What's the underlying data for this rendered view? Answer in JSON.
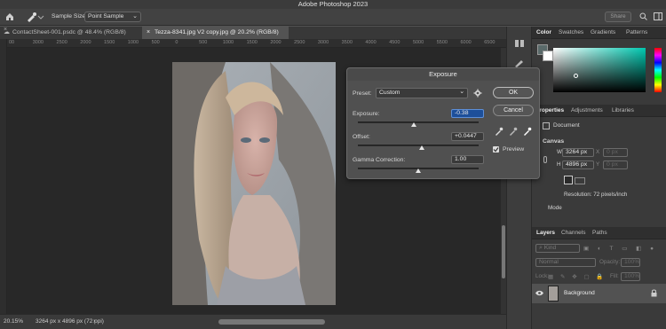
{
  "app": {
    "title": "Adobe Photoshop 2023"
  },
  "options_bar": {
    "sample_size_label": "Sample Size:",
    "sample_size_value": "Point Sample",
    "share_label": "Share"
  },
  "tabs": [
    {
      "label": "ContactSheet-001.psdc @ 48.4% (RGB/8)",
      "active": false
    },
    {
      "label": "Tezza-8341.jpg V2 copy.jpg @ 20.2% (RGB/8)",
      "active": true
    }
  ],
  "ruler": {
    "marks": [
      "00",
      "3000",
      "2500",
      "2000",
      "1500",
      "1000",
      "500",
      "0",
      "500",
      "1000",
      "1500",
      "2000",
      "2500",
      "3000",
      "3500",
      "4000",
      "4500",
      "5000",
      "5500",
      "6000",
      "6500"
    ]
  },
  "status": {
    "zoom": "20.15%",
    "doc_info": "3264 px x 4896 px (72 ppi)"
  },
  "dialog": {
    "title": "Exposure",
    "preset_label": "Preset:",
    "preset_value": "Custom",
    "ok_label": "OK",
    "cancel_label": "Cancel",
    "preview_label": "Preview",
    "preview_checked": true,
    "exposure_label": "Exposure:",
    "exposure_value": "-0.38",
    "offset_label": "Offset:",
    "offset_value": "+0.0447",
    "gamma_label": "Gamma Correction:",
    "gamma_value": "1.00"
  },
  "color_panel": {
    "tabs": [
      "Color",
      "Swatches",
      "Gradients",
      "Patterns"
    ],
    "picker_hue_color": "#00c8b0"
  },
  "properties_panel": {
    "tabs": [
      "Properties",
      "Adjustments",
      "Libraries"
    ],
    "document_label": "Document",
    "canvas_label": "Canvas",
    "w_label": "W",
    "w_value": "3264 px",
    "h_label": "H",
    "h_value": "4896 px",
    "x_label": "X",
    "y_label": "Y",
    "x_value": "0 px",
    "y_value": "0 px",
    "resolution": "Resolution: 72 pixels/inch",
    "mode_label": "Mode"
  },
  "layers_panel": {
    "tabs": [
      "Layers",
      "Channels",
      "Paths"
    ],
    "search_placeholder": "Kind",
    "blend_mode": "Normal",
    "opacity_label": "Opacity:",
    "opacity_value": "100%",
    "lock_label": "Lock:",
    "fill_label": "Fill:",
    "fill_value": "100%",
    "layers": [
      {
        "name": "Background",
        "visible": true,
        "locked": true
      }
    ]
  }
}
